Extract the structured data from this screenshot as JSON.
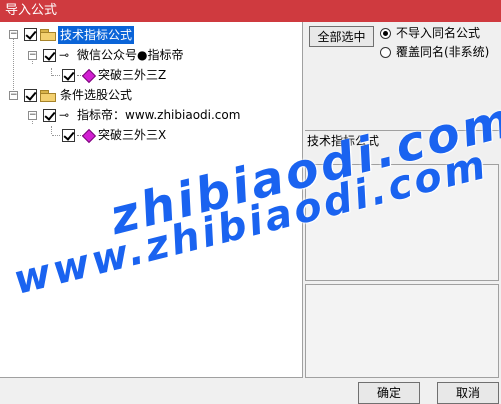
{
  "window": {
    "title": "导入公式"
  },
  "tree": {
    "root1": {
      "label": "技术指标公式"
    },
    "root1_child": {
      "label": "微信公众号●指标帝"
    },
    "root1_leaf": {
      "label": "突破三外三Z"
    },
    "root2": {
      "label": "条件选股公式"
    },
    "root2_child": {
      "label": "指标帝：www.zhibiaodi.com"
    },
    "root2_leaf": {
      "label": "突破三外三X"
    }
  },
  "options": {
    "select_all_label": "全部选中",
    "radio_no_import": "不导入同名公式",
    "radio_overwrite": "覆盖同名(非系统)"
  },
  "info": {
    "section_title": "技术指标公式"
  },
  "buttons": {
    "ok": "确定",
    "cancel": "取消"
  },
  "watermark": {
    "line1": "zhibiaodi.com",
    "line2": "www.zhibiaodi.com"
  },
  "colors": {
    "titlebar": "#cf3a3f",
    "selection": "#0a64d8",
    "watermark": "#1a63f0"
  }
}
